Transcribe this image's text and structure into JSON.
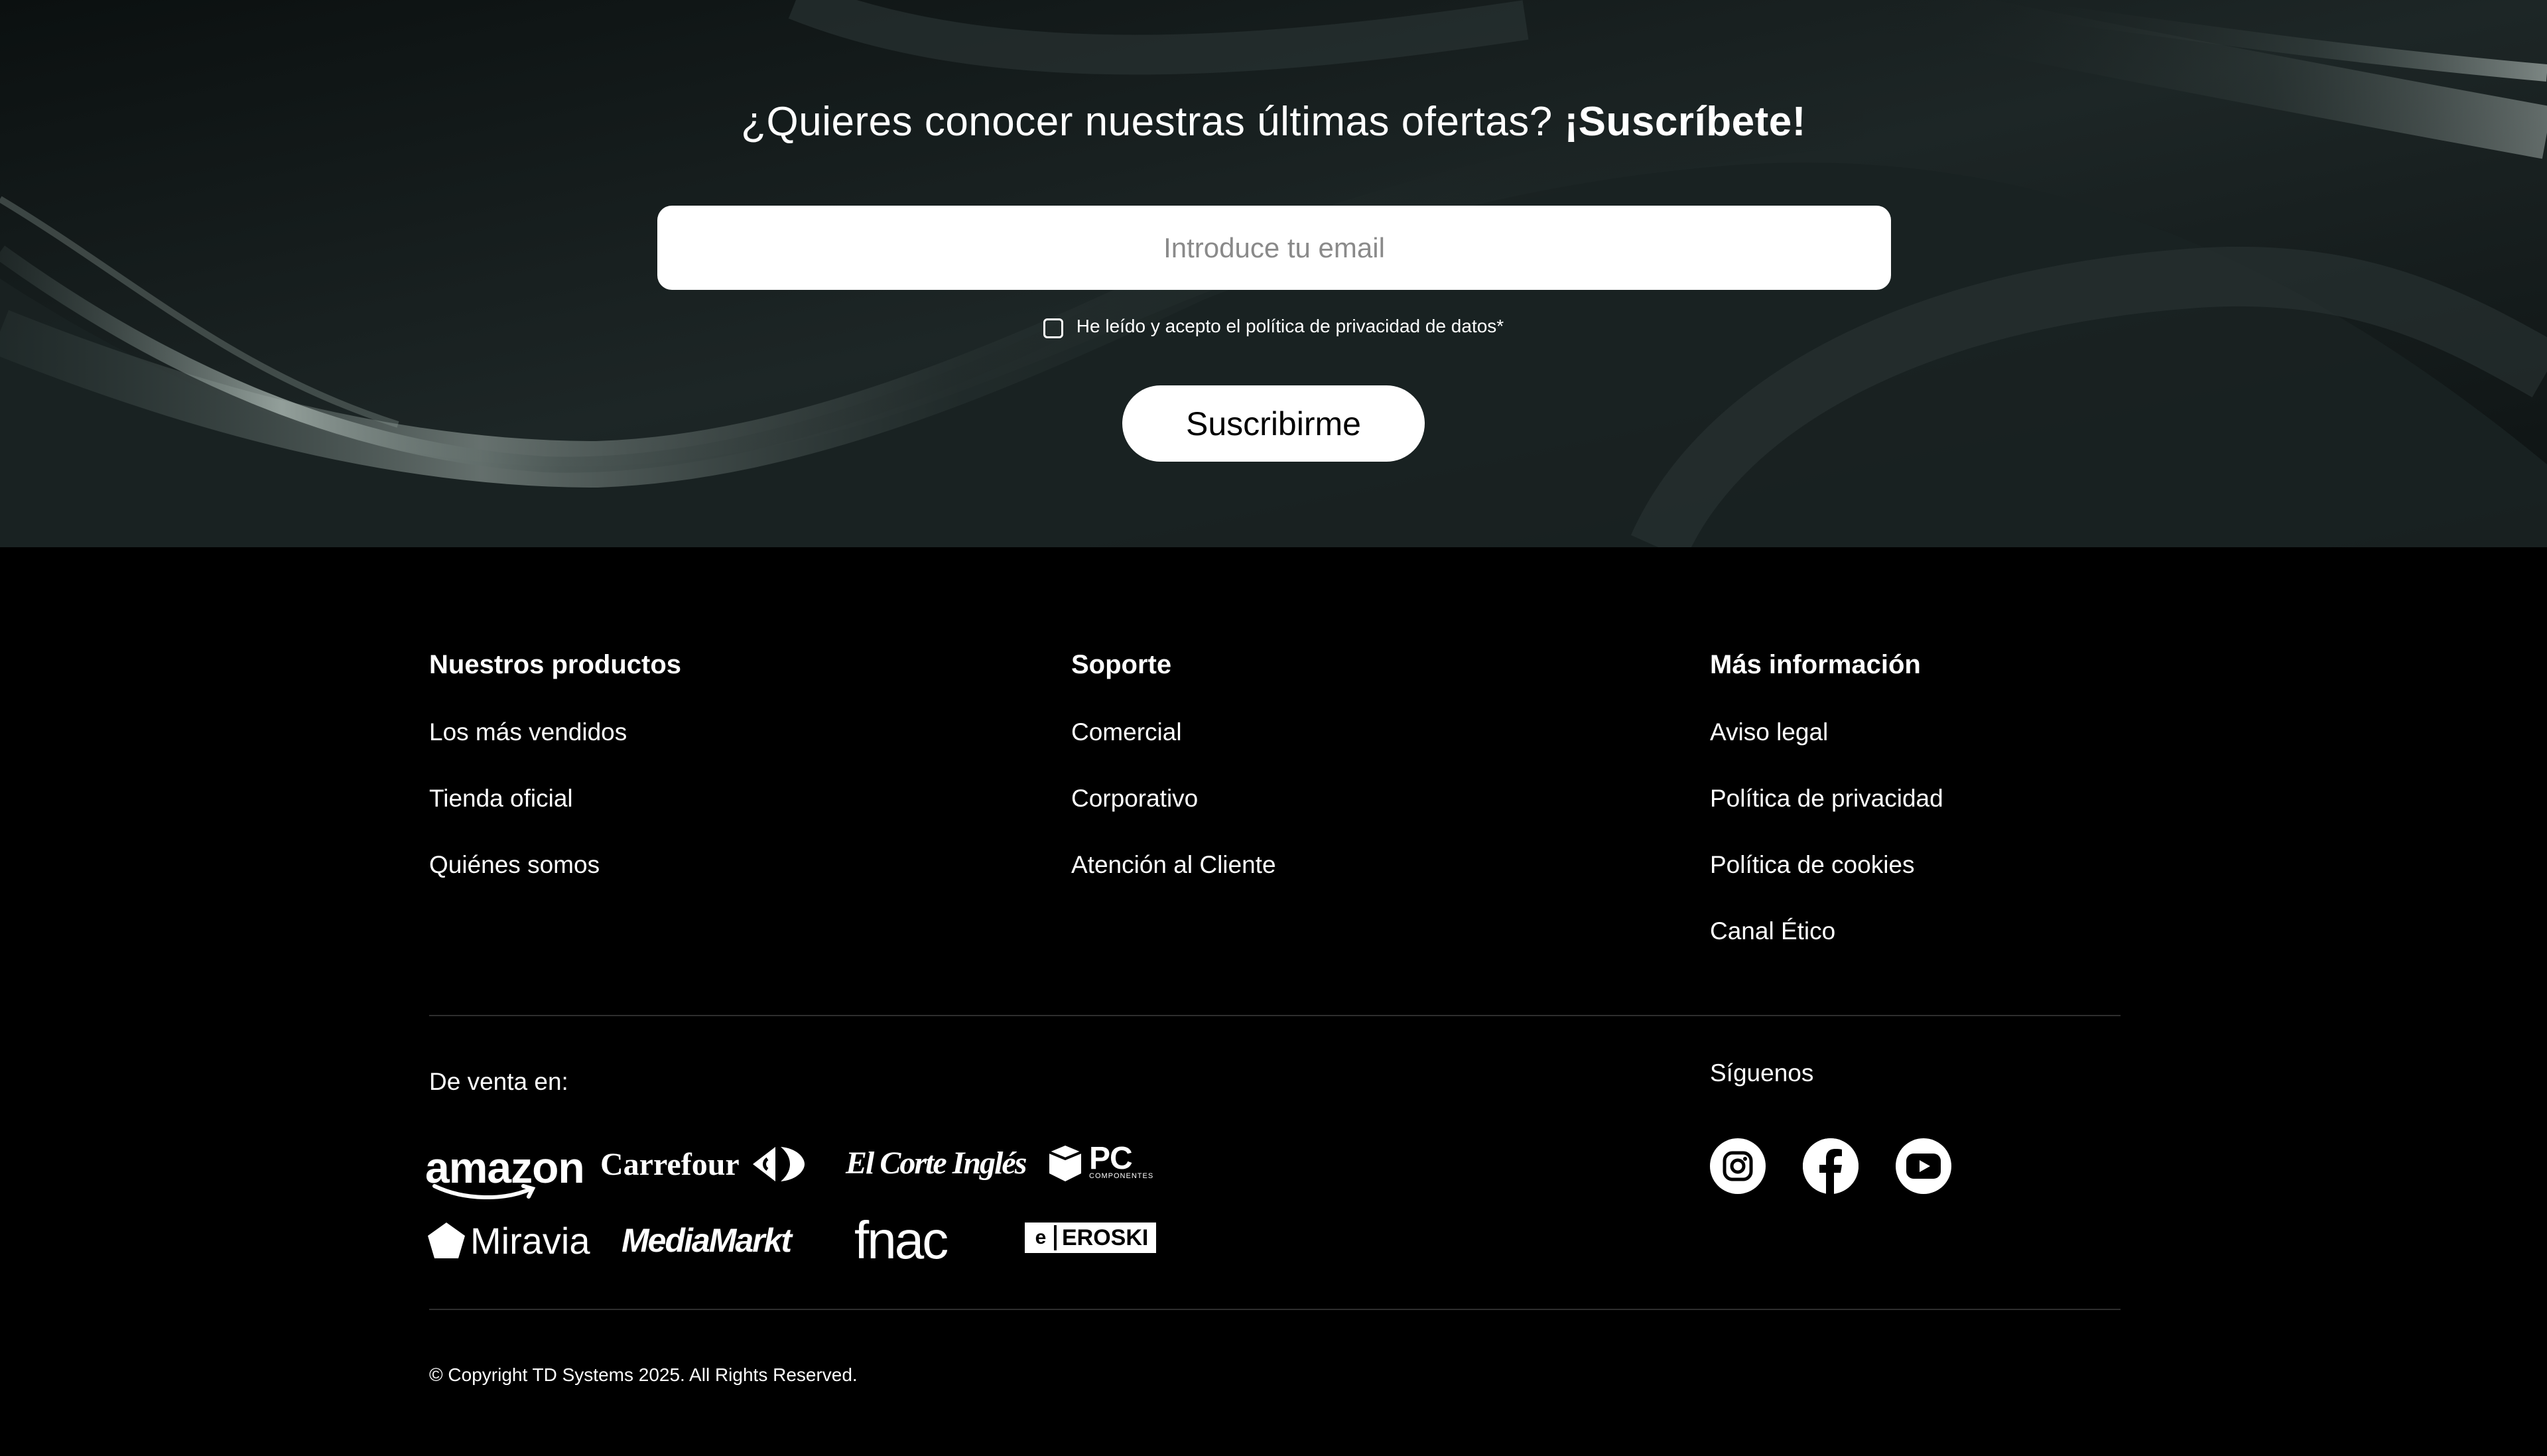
{
  "newsletter": {
    "title_regular": "¿Quieres conocer nuestras últimas ofertas?",
    "title_bold": "¡Suscríbete!",
    "email_placeholder": "Introduce tu email",
    "consent_label": "He leído y acepto el política de privacidad de datos*",
    "consent_checked": false,
    "subscribe_label": "Suscribirme"
  },
  "footer": {
    "columns": [
      {
        "title": "Nuestros productos",
        "links": [
          "Los más vendidos",
          "Tienda oficial",
          "Quiénes somos"
        ]
      },
      {
        "title": "Soporte",
        "links": [
          "Comercial",
          "Corporativo",
          "Atención al Cliente"
        ]
      },
      {
        "title": "Más información",
        "links": [
          "Aviso legal",
          "Política de privacidad",
          "Política de cookies",
          "Canal Ético"
        ]
      }
    ],
    "sale_label": "De venta en:",
    "retailers": [
      "amazon",
      "Carrefour",
      "El Corte Inglés",
      "PC",
      "COMPONENTES",
      "Miravia",
      "MediaMarkt",
      "fnac",
      "EROSKI"
    ],
    "follow_label": "Síguenos",
    "social": [
      "instagram-icon",
      "facebook-icon",
      "youtube-icon"
    ],
    "copyright": "© Copyright TD Systems 2025. All Rights Reserved."
  }
}
